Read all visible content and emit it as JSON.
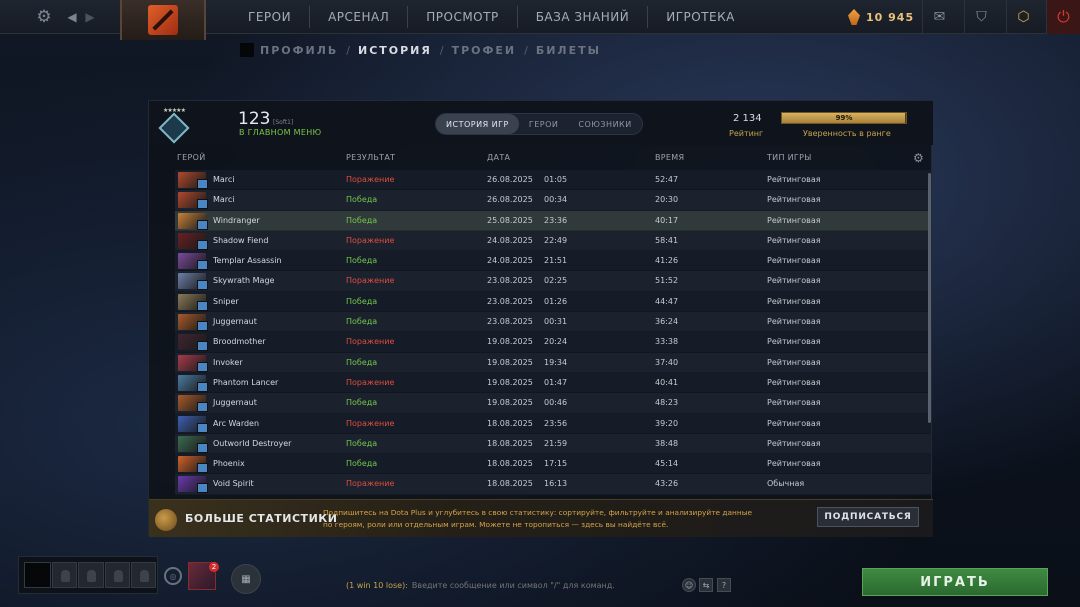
{
  "topbar": {
    "nav": [
      "ГЕРОИ",
      "АРСЕНАЛ",
      "ПРОСМОТР",
      "БАЗА ЗНАНИЙ",
      "ИГРОТЕКА"
    ],
    "shards": "10 945",
    "icons": {
      "settings": "gear-icon",
      "back": "chevron-left-icon",
      "forward": "chevron-right-icon",
      "mail": "mail-icon",
      "armory": "armory-icon",
      "plus": "dota-plus-icon",
      "power": "power-icon"
    }
  },
  "subnav": {
    "items": [
      "ПРОФИЛЬ",
      "ИСТОРИЯ",
      "ТРОФЕИ",
      "БИЛЕТЫ"
    ],
    "active": "ИСТОРИЯ",
    "separator": "/"
  },
  "profile": {
    "name": "123",
    "tag": "[Soft1]",
    "status": "В ГЛАВНОМ МЕНЮ",
    "tabs": [
      "ИСТОРИЯ ИГР",
      "ГЕРОИ",
      "СОЮЗНИКИ"
    ],
    "active_tab": "ИСТОРИЯ ИГР",
    "rating": "2 134",
    "rating_label": "Рейтинг",
    "confidence": "99%",
    "confidence_fraction": 0.99,
    "confidence_label": "Уверенность в ранге"
  },
  "table": {
    "columns": [
      "ГЕРОЙ",
      "РЕЗУЛЬТАТ",
      "ДАТА",
      "ВРЕМЯ",
      "ТИП ИГРЫ"
    ],
    "rows": [
      {
        "hero": "Marci",
        "result": "Поражение",
        "date": "26.08.2025",
        "time": "01:05",
        "duration": "52:47",
        "mode": "Рейтинговая"
      },
      {
        "hero": "Marci",
        "result": "Победа",
        "date": "26.08.2025",
        "time": "00:34",
        "duration": "20:30",
        "mode": "Рейтинговая"
      },
      {
        "hero": "Windranger",
        "result": "Победа",
        "date": "25.08.2025",
        "time": "23:36",
        "duration": "40:17",
        "mode": "Рейтинговая"
      },
      {
        "hero": "Shadow Fiend",
        "result": "Поражение",
        "date": "24.08.2025",
        "time": "22:49",
        "duration": "58:41",
        "mode": "Рейтинговая"
      },
      {
        "hero": "Templar Assassin",
        "result": "Победа",
        "date": "24.08.2025",
        "time": "21:51",
        "duration": "41:26",
        "mode": "Рейтинговая"
      },
      {
        "hero": "Skywrath Mage",
        "result": "Поражение",
        "date": "23.08.2025",
        "time": "02:25",
        "duration": "51:52",
        "mode": "Рейтинговая"
      },
      {
        "hero": "Sniper",
        "result": "Победа",
        "date": "23.08.2025",
        "time": "01:26",
        "duration": "44:47",
        "mode": "Рейтинговая"
      },
      {
        "hero": "Juggernaut",
        "result": "Победа",
        "date": "23.08.2025",
        "time": "00:31",
        "duration": "36:24",
        "mode": "Рейтинговая"
      },
      {
        "hero": "Broodmother",
        "result": "Поражение",
        "date": "19.08.2025",
        "time": "20:24",
        "duration": "33:38",
        "mode": "Рейтинговая"
      },
      {
        "hero": "Invoker",
        "result": "Победа",
        "date": "19.08.2025",
        "time": "19:34",
        "duration": "37:40",
        "mode": "Рейтинговая"
      },
      {
        "hero": "Phantom Lancer",
        "result": "Поражение",
        "date": "19.08.2025",
        "time": "01:47",
        "duration": "40:41",
        "mode": "Рейтинговая"
      },
      {
        "hero": "Juggernaut",
        "result": "Победа",
        "date": "19.08.2025",
        "time": "00:46",
        "duration": "48:23",
        "mode": "Рейтинговая"
      },
      {
        "hero": "Arc Warden",
        "result": "Поражение",
        "date": "18.08.2025",
        "time": "23:56",
        "duration": "39:20",
        "mode": "Рейтинговая"
      },
      {
        "hero": "Outworld Destroyer",
        "result": "Победа",
        "date": "18.08.2025",
        "time": "21:59",
        "duration": "38:48",
        "mode": "Рейтинговая"
      },
      {
        "hero": "Phoenix",
        "result": "Победа",
        "date": "18.08.2025",
        "time": "17:15",
        "duration": "45:14",
        "mode": "Рейтинговая"
      },
      {
        "hero": "Void Spirit",
        "result": "Поражение",
        "date": "18.08.2025",
        "time": "16:13",
        "duration": "43:26",
        "mode": "Обычная"
      }
    ],
    "highlight_row": 2,
    "hero_colors": [
      "#b0492c",
      "#b0492c",
      "#c7813a",
      "#6a1f22",
      "#7b4a9c",
      "#6d7fa8",
      "#8a7a56",
      "#a85a2a",
      "#3f2530",
      "#a63c4a",
      "#4a7aa0",
      "#a85a2a",
      "#3e5fb0",
      "#3c6a52",
      "#d0622a",
      "#6a3ab0"
    ]
  },
  "dota_plus": {
    "title": "БОЛЬШЕ СТАТИСТИКИ",
    "text": "Подпишитесь на Dota Plus и углубитесь в свою статистику: сортируйте, фильтруйте и анализируйте данные по героям, роли или отдельным играм. Можете не торопиться — здесь вы найдёте всё.",
    "button": "ПОДПИСАТЬСЯ"
  },
  "bottom": {
    "friend_badge": "2",
    "chat_channel": "(1 win 10 lose):",
    "chat_placeholder": "Введите сообщение или символ \"/\" для команд.",
    "help": "?",
    "play": "ИГРАТЬ"
  }
}
